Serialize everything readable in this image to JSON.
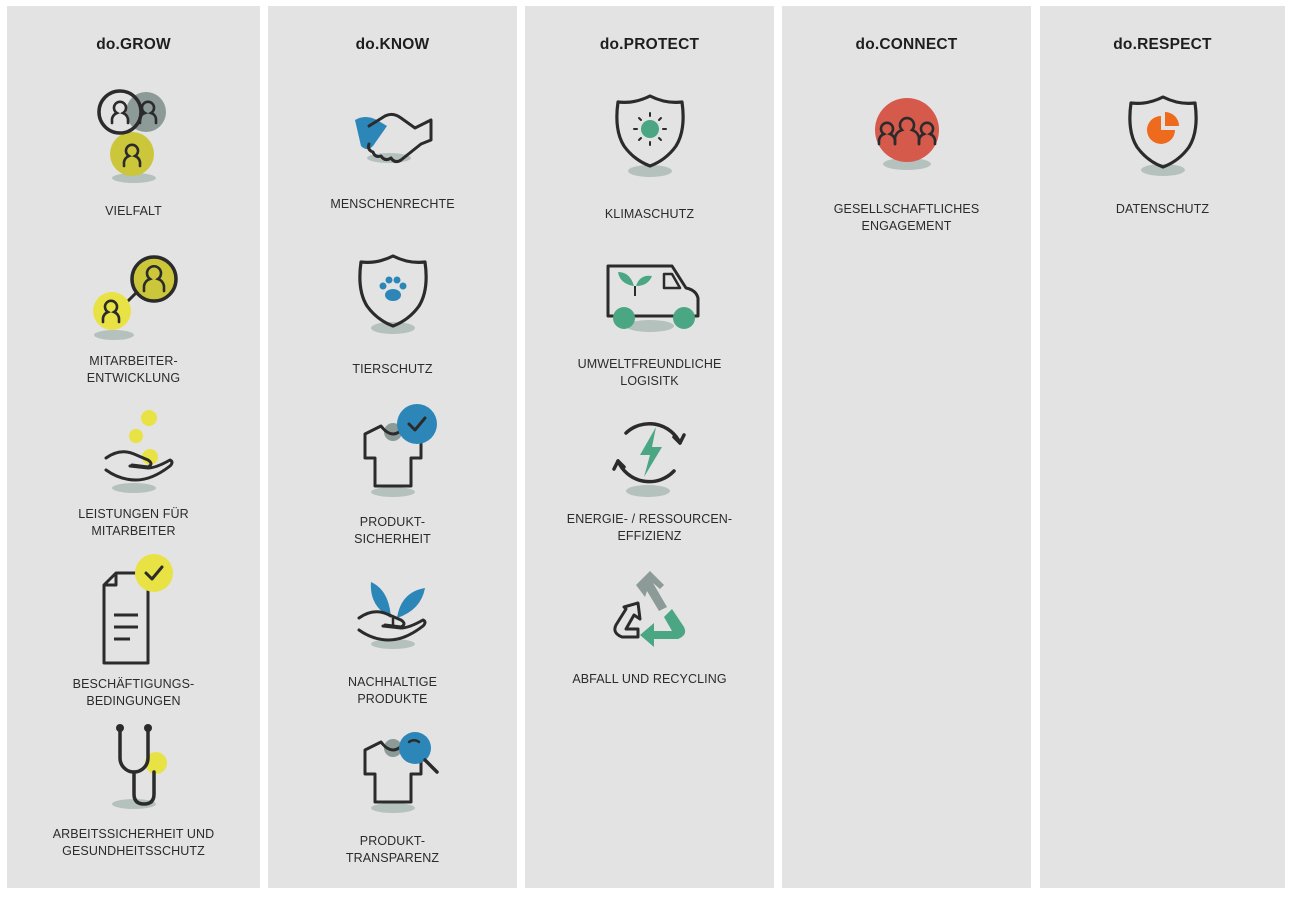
{
  "colors": {
    "background": "#e3e3e3",
    "stroke": "#2b2b2b",
    "yellow": "#ccc73a",
    "lightYellow": "#e8e245",
    "grey": "#8c9b97",
    "shadow": "#b4c1bd",
    "blue": "#2c86b8",
    "green": "#4aa683",
    "red": "#d55a4c",
    "orange": "#ee6a1c"
  },
  "columns": [
    {
      "title": "do.GROW",
      "items": [
        {
          "icon": "people-diversity-icon",
          "label": "VIELFALT"
        },
        {
          "icon": "employee-development-icon",
          "label": "MITARBEITER-\nENTWICKLUNG"
        },
        {
          "icon": "hand-coins-icon",
          "label": "LEISTUNGEN FÜR\nMITARBEITER"
        },
        {
          "icon": "document-check-icon",
          "label": "BESCHÄFTIGUNGS-\nBEDINGUNGEN"
        },
        {
          "icon": "stethoscope-icon",
          "label": "ARBEITSSICHERHEIT UND\nGESUNDHEITSSCHUTZ"
        }
      ]
    },
    {
      "title": "do.KNOW",
      "items": [
        {
          "icon": "handshake-icon",
          "label": "MENSCHENRECHTE"
        },
        {
          "icon": "shield-paw-icon",
          "label": "TIERSCHUTZ"
        },
        {
          "icon": "shirt-check-icon",
          "label": "PRODUKT-\nSICHERHEIT"
        },
        {
          "icon": "hand-plant-icon",
          "label": "NACHHALTIGE\nPRODUKTE"
        },
        {
          "icon": "shirt-magnifier-icon",
          "label": "PRODUKT-\nTRANSPARENZ"
        }
      ]
    },
    {
      "title": "do.PROTECT",
      "items": [
        {
          "icon": "shield-sun-icon",
          "label": "KLIMASCHUTZ"
        },
        {
          "icon": "eco-van-icon",
          "label": "UMWELTFREUNDLICHE\nLOGISITK"
        },
        {
          "icon": "energy-cycle-icon",
          "label": "ENERGIE- / RESSOURCEN-\nEFFIZIENZ"
        },
        {
          "icon": "recycling-icon",
          "label": "ABFALL UND RECYCLING"
        }
      ]
    },
    {
      "title": "do.CONNECT",
      "items": [
        {
          "icon": "community-group-icon",
          "label": "GESELLSCHAFTLICHES\nENGAGEMENT"
        }
      ]
    },
    {
      "title": "do.RESPECT",
      "items": [
        {
          "icon": "shield-data-icon",
          "label": "DATENSCHUTZ"
        }
      ]
    }
  ]
}
